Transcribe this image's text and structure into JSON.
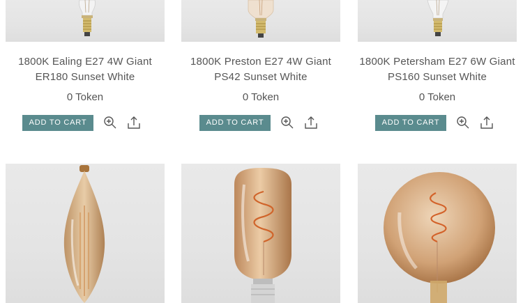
{
  "products": [
    {
      "title": "1800K Ealing E27 4W Giant ER180 Sunset White",
      "price": "0 Token",
      "cart_label": "ADD TO CART",
      "image": "ER180-bulb"
    },
    {
      "title": "1800K Preston E27 4W Giant PS42 Sunset White",
      "price": "0 Token",
      "cart_label": "ADD TO CART",
      "image": "PS42-bulb"
    },
    {
      "title": "1800K Petersham E27 6W Giant PS160 Sunset White",
      "price": "0 Token",
      "cart_label": "ADD TO CART",
      "image": "PS160-bulb"
    }
  ],
  "next_row": [
    {
      "image": "elongated-amber-bulb"
    },
    {
      "image": "tubular-amber-spiral-bulb"
    },
    {
      "image": "globe-amber-spiral-bulb"
    }
  ],
  "colors": {
    "button_bg": "#5a8b8e",
    "button_text": "#ffffff",
    "text": "#555555",
    "image_bg": "#e6e6e6"
  },
  "icons": [
    "zoom-in-icon",
    "share-icon"
  ]
}
